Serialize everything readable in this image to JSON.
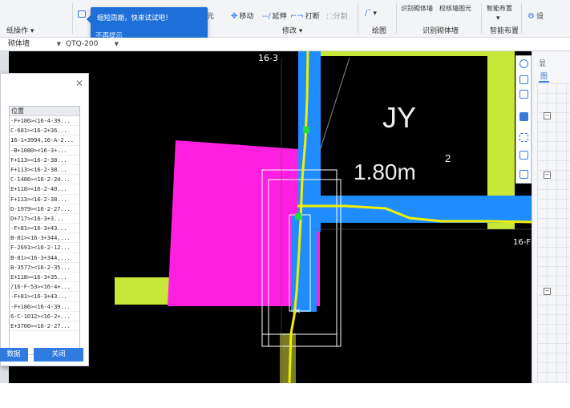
{
  "ribbon": {
    "left_group_label": "纸操作",
    "tooltip_message": "缩短周期，快来试试吧！",
    "tooltip_dismiss": "不再提示",
    "partial_label_yuan": "元",
    "move_label": "移动",
    "extend_label": "延伸",
    "break_label": "打断",
    "split_label": "分割",
    "modify_group": "修改",
    "draw_group": "绘图",
    "identify_top_1": "识别砌体墙",
    "identify_top_2": "校核墙图元",
    "identify_group": "识别砌体墙",
    "smart_top": "智能布置",
    "smart_group": "智能布置",
    "settings_label": "设"
  },
  "selectors": {
    "category": "砌体墙",
    "component": "QTQ-200"
  },
  "canvas": {
    "axis_top_label": "16-3",
    "axis_right_label": "16-F",
    "room_name": "JY",
    "room_area": "1.80m",
    "room_area_superscript": "2"
  },
  "dialog": {
    "column_header": "位置",
    "rows": [
      "-F+186><16-4-39...",
      "C-681><16-2+36...",
      "16-1+3994,16-A-2...",
      "-B+1080><16-3+...",
      "F+113><16-2-38...",
      "F+113><16-2-38...",
      "C-1486><16-2-24...",
      "E+118><16-2-40...",
      "F+113><16-2-38...",
      "D-1979><16-2-27...",
      "D+717><16-3+3...",
      "-F+81><16-3+43...",
      "B-81><16-3+344,...",
      "F-2691><16-2-12...",
      "B-81><16-3+344,...",
      "B-3577><16-2-35...",
      "E+118><16-3+35...",
      "/16-F-53><16-4+...",
      "-F+81><16-3+43...",
      "-F+186><16-4-39...",
      "6-C-1012><16-2+...",
      "E+3700><16-2-27..."
    ],
    "left_button": "数据",
    "close_button": "关闭"
  },
  "right_panel": {
    "header": "显",
    "tab": "图"
  }
}
